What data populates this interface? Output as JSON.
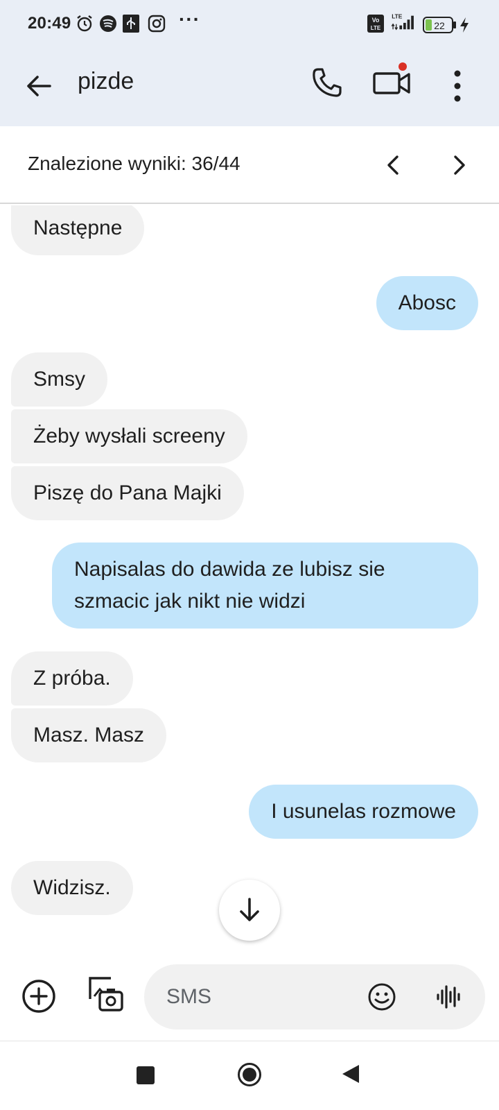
{
  "status_bar": {
    "time": "20:49",
    "icons": [
      "alarm-icon",
      "spotify-icon",
      "usb-icon",
      "instagram-icon",
      "more-dots-icon",
      "volte-icon",
      "signal-icon",
      "battery-icon",
      "charging-icon"
    ],
    "more": "···",
    "volte_top": "Vo",
    "volte_bottom": "LTE",
    "network_label": "LTE",
    "battery_level": "22"
  },
  "app_bar": {
    "title": "pizde",
    "actions": [
      "back-arrow-icon",
      "phone-icon",
      "video-camera-icon",
      "more-vert-icon"
    ]
  },
  "search": {
    "results_text": "Znalezione wyniki: 36/44"
  },
  "messages": [
    {
      "direction": "incoming",
      "text": "Następne"
    },
    {
      "direction": "outgoing",
      "text": "Abosc"
    },
    {
      "direction": "incoming",
      "text": "Smsy"
    },
    {
      "direction": "incoming",
      "text": "Żeby wysłali screeny"
    },
    {
      "direction": "incoming",
      "text": "Piszę do Pana Majki"
    },
    {
      "direction": "outgoing",
      "text": "Napisalas do dawida ze lubisz sie szmacic jak nikt nie widzi"
    },
    {
      "direction": "incoming",
      "text": "Z próba."
    },
    {
      "direction": "incoming",
      "text": "Masz. Masz"
    },
    {
      "direction": "outgoing",
      "text": "I usunelas rozmowe"
    },
    {
      "direction": "incoming",
      "text": "Widzisz."
    }
  ],
  "composer": {
    "placeholder": "SMS"
  },
  "colors": {
    "header_bg": "#e9eef6",
    "incoming_bubble": "#f1f1f1",
    "outgoing_bubble": "#c2e5fb",
    "video_badge": "#d93025",
    "battery_fill": "#7cc24f"
  }
}
